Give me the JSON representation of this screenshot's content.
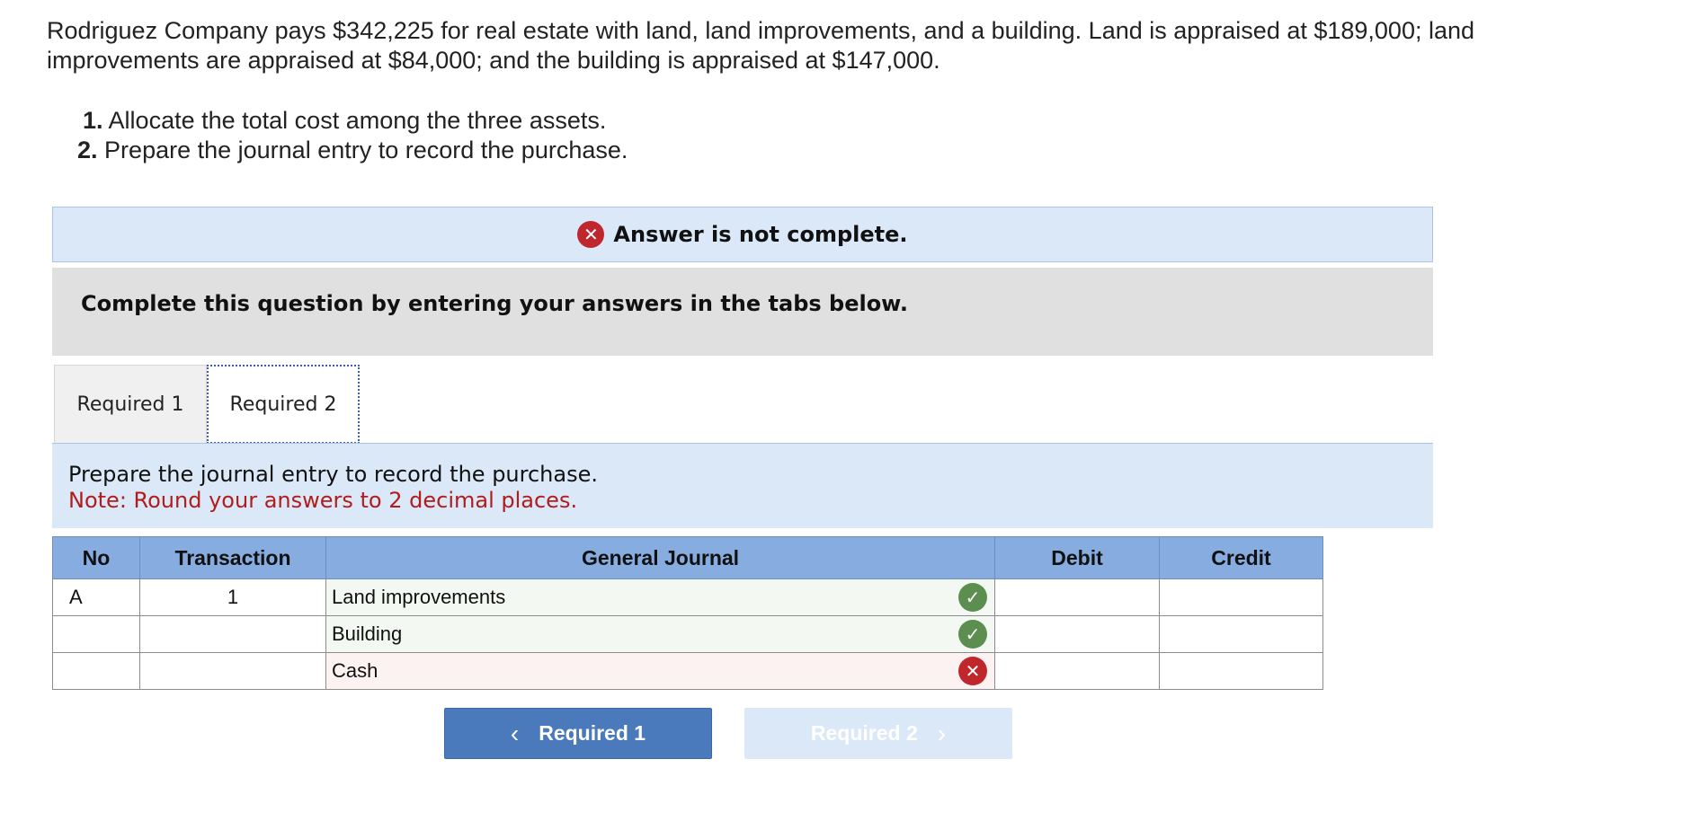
{
  "problem": {
    "text": "Rodriguez Company pays $342,225 for real estate with land, land improvements, and a building. Land is appraised at $189,000; land improvements are appraised at $84,000; and the building is appraised at $147,000.",
    "steps": [
      {
        "num": "1.",
        "text": "Allocate the total cost among the three assets."
      },
      {
        "num": "2.",
        "text": "Prepare the journal entry to record the purchase."
      }
    ]
  },
  "status": {
    "icon": "x-circle-icon",
    "text": "Answer is not complete."
  },
  "instructions": "Complete this question by entering your answers in the tabs below.",
  "tabs": [
    {
      "label": "Required 1",
      "active": false
    },
    {
      "label": "Required 2",
      "active": true
    }
  ],
  "prompt": {
    "line1": "Prepare the journal entry to record the purchase.",
    "line2": "Note: Round your answers to 2 decimal places."
  },
  "journal": {
    "headers": {
      "no": "No",
      "transaction": "Transaction",
      "account": "General Journal",
      "debit": "Debit",
      "credit": "Credit"
    },
    "rows": [
      {
        "no": "A",
        "transaction": "1",
        "account": "Land improvements",
        "status": "correct",
        "debit": "",
        "credit": ""
      },
      {
        "no": "",
        "transaction": "",
        "account": "Building",
        "status": "correct",
        "debit": "",
        "credit": ""
      },
      {
        "no": "",
        "transaction": "",
        "account": "Cash",
        "status": "incorrect",
        "debit": "",
        "credit": ""
      }
    ]
  },
  "nav": {
    "prev_label": "Required 1",
    "next_label": "Required 2"
  },
  "colors": {
    "header_blue": "#86ace0",
    "panel_blue": "#dbe8f7",
    "button_blue": "#4a7abc",
    "correct_green": "#5b8e4f",
    "incorrect_red": "#c0272d",
    "note_red": "#b11c1c"
  }
}
